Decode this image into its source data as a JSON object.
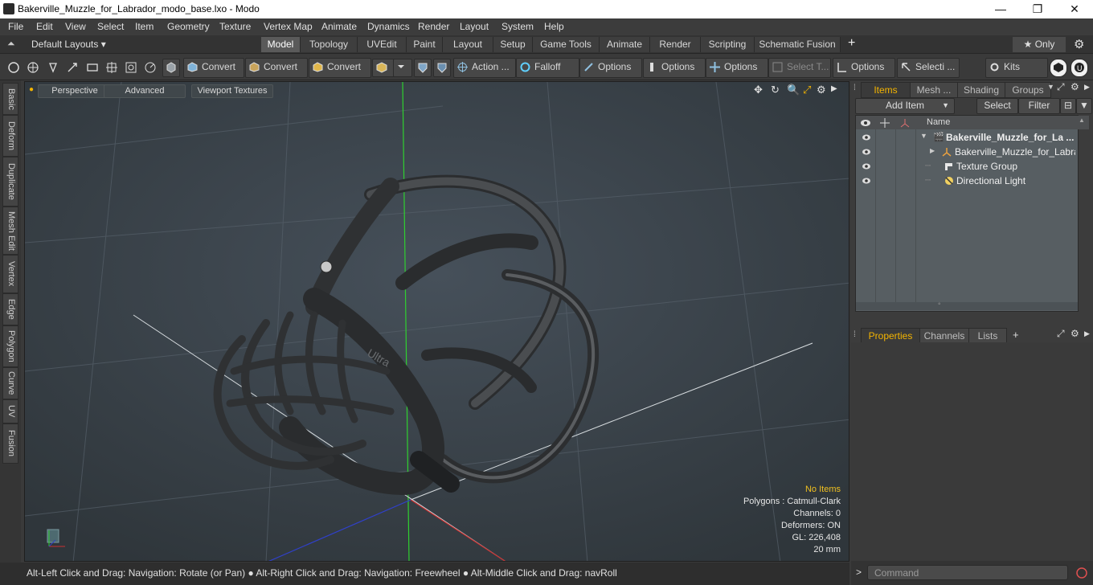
{
  "window": {
    "title": "Bakerville_Muzzle_for_Labrador_modo_base.lxo - Modo",
    "minimize": "—",
    "maximize": "❐",
    "close": "✕"
  },
  "menu": [
    "File",
    "Edit",
    "View",
    "Select",
    "Item",
    "Geometry",
    "Texture",
    "Vertex Map",
    "Animate",
    "Dynamics",
    "Render",
    "Layout",
    "System",
    "Help"
  ],
  "layouts": {
    "label": "Default Layouts ▾"
  },
  "tabs": [
    "Model",
    "Topology",
    "UVEdit",
    "Paint",
    "Layout",
    "Setup",
    "Game Tools",
    "Animate",
    "Render",
    "Scripting",
    "Schematic Fusion"
  ],
  "tabs_active": "Model",
  "only_label": "★  Only",
  "toolbar": {
    "convert1": "Convert",
    "convert2": "Convert",
    "convert3": "Convert",
    "action": "Action ...",
    "falloff": "Falloff",
    "options1": "Options",
    "options2": "Options",
    "options3": "Options",
    "select_t": "Select T...",
    "options4": "Options",
    "selecti": "Selecti ...",
    "kits": "Kits"
  },
  "left_tabs": [
    "Basic",
    "Deform",
    "Duplicate",
    "Mesh Edit",
    "Vertex",
    "Edge",
    "Polygon",
    "Curve",
    "UV",
    "Fusion"
  ],
  "viewport": {
    "header": [
      "Perspective",
      "Advanced",
      "Viewport Textures"
    ],
    "info": {
      "selection": "No Items",
      "polygons": "Polygons : Catmull-Clark",
      "channels": "Channels: 0",
      "deformers": "Deformers: ON",
      "gl": "GL: 226,408",
      "scale": "20 mm"
    },
    "model_label": "Ultra"
  },
  "status": {
    "hint": "Alt-Left Click and Drag: Navigation: Rotate (or Pan) ● Alt-Right Click and Drag: Navigation: Freewheel ● Alt-Middle Click and Drag: navRoll"
  },
  "items_panel": {
    "tabs": [
      "Items",
      "Mesh ...",
      "Shading",
      "Groups"
    ],
    "add_item": "Add Item",
    "select": "Select",
    "filter": "Filter",
    "col_name": "Name",
    "rows": [
      {
        "name": "Bakerville_Muzzle_for_La ...",
        "icon": "scene-icon",
        "expander": "▼"
      },
      {
        "name": "Bakerville_Muzzle_for_Labra...",
        "icon": "mesh-icon",
        "expander": "▶"
      },
      {
        "name": "Texture Group",
        "icon": "texture-group-icon",
        "expander": ""
      },
      {
        "name": "Directional Light",
        "icon": "light-icon",
        "expander": ""
      }
    ]
  },
  "props_panel": {
    "tabs": [
      "Properties",
      "Channels",
      "Lists"
    ],
    "add": "+"
  },
  "command": {
    "placeholder": "Command",
    "prompt": ">"
  },
  "colors": {
    "accent": "#f4b400",
    "viewport_bg": "#3a4146",
    "axis_x": "#c83030",
    "axis_y": "#30c030",
    "axis_z": "#3040c8"
  }
}
